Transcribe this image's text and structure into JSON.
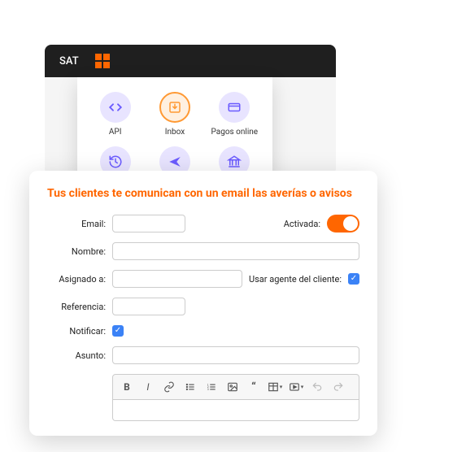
{
  "topbar": {
    "label": "SAT"
  },
  "dropdown": {
    "items": [
      {
        "label": "API",
        "icon": "code"
      },
      {
        "label": "Inbox",
        "icon": "inbox"
      },
      {
        "label": "Pagos online",
        "icon": "card"
      },
      {
        "label": "",
        "icon": "history"
      },
      {
        "label": "",
        "icon": "send"
      },
      {
        "label": "",
        "icon": "bank"
      }
    ]
  },
  "form": {
    "title": "Tus clientes te comunican con un email las averías o avisos",
    "labels": {
      "email": "Email:",
      "activated": "Activada:",
      "name": "Nombre:",
      "assigned": "Asignado a:",
      "useAgent": "Usar agente del cliente:",
      "reference": "Referencia:",
      "notify": "Notificar:",
      "subject": "Asunto:"
    },
    "values": {
      "email": "",
      "name": "",
      "assigned": "",
      "reference": "",
      "subject": "",
      "activated": true,
      "useAgent": true,
      "notify": true
    }
  },
  "colors": {
    "accent": "#ff6600",
    "iconPurple": "#6b5bff"
  }
}
